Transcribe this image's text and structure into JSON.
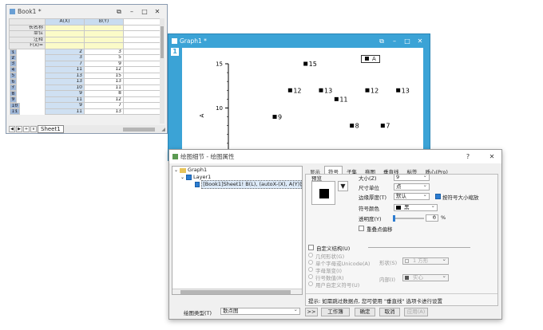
{
  "book": {
    "title": "Book1 *",
    "columns": [
      "A(X)",
      "B(Y)"
    ],
    "row_headers": [
      "长名称",
      "单位",
      "注释",
      "F(x)="
    ],
    "rows": [
      [
        "1",
        "2",
        "3"
      ],
      [
        "2",
        "3",
        "5"
      ],
      [
        "3",
        "7",
        "9"
      ],
      [
        "4",
        "11",
        "12"
      ],
      [
        "5",
        "13",
        "15"
      ],
      [
        "6",
        "13",
        "13"
      ],
      [
        "7",
        "10",
        "11"
      ],
      [
        "8",
        "9",
        "8"
      ],
      [
        "9",
        "11",
        "12"
      ],
      [
        "10",
        "9",
        "7"
      ],
      [
        "11",
        "11",
        "13"
      ]
    ],
    "sheet_tab": "Sheet1",
    "colors": {
      "selection": "#9eb7d8",
      "column_header": "#c9dcf0",
      "meta_rows": "#fbfbc8"
    }
  },
  "graph": {
    "title": "Graph1 *",
    "layer_number": "1",
    "legend_label": "A",
    "colors": {
      "frame": "#3ba3d6"
    }
  },
  "chart_data": {
    "type": "scatter",
    "x_label": "A",
    "y_ticks": [
      "15",
      "10"
    ],
    "ylim": [
      4,
      15
    ],
    "xlim": [
      0,
      12
    ],
    "points": [
      {
        "x": 3,
        "y": 9,
        "label": "9"
      },
      {
        "x": 4,
        "y": 12,
        "label": "12"
      },
      {
        "x": 5,
        "y": 15,
        "label": "15"
      },
      {
        "x": 6,
        "y": 12,
        "label": "13"
      },
      {
        "x": 7,
        "y": 11,
        "label": "11"
      },
      {
        "x": 8,
        "y": 8,
        "label": "8"
      },
      {
        "x": 9,
        "y": 12,
        "label": "12"
      },
      {
        "x": 10,
        "y": 8,
        "label": "7"
      },
      {
        "x": 11,
        "y": 12,
        "label": "13"
      }
    ]
  },
  "dialog": {
    "title": "绘图细节 - 绘图属性",
    "help": "?",
    "close": "✕",
    "tree": {
      "graph": "Graph1",
      "layer": "Layer1",
      "plot": "[Book1]Sheet1! B(L), (autoX-(X), A(Y)) [1*:1]"
    },
    "tabs": [
      "显示",
      "符号",
      "子集",
      "拖图",
      "垂直线",
      "标签",
      "质心(Pro)"
    ],
    "active_tab": "符号",
    "preview_label": "预览",
    "size_label": "大小(Z)",
    "size_value": "9",
    "size_unit_label": "尺寸单位",
    "size_unit_value": "点",
    "edge_label": "边缘厚度(T)",
    "edge_value": "默认",
    "scale_check": "按符号大小缩放",
    "color_label": "符号颜色",
    "color_value": "黑",
    "transparency_label": "透明度(Y)",
    "transparency_value": "0",
    "transparency_unit": "%",
    "overlap_check": "重叠点偏移",
    "custom_check": "自定义结构(U)",
    "radio_items": [
      "几何形状(G)",
      "单个字母或Unicode(A)",
      "字母渐变(I)",
      "行号数值(R)",
      "用户自定义符号(U)"
    ],
    "shape_label": "形状(S)",
    "shape_value": "1 方形",
    "inside_label": "内部(I)",
    "inside_value": "实心",
    "hint": "提示: 如需跳过数据点, 您可使用 \"垂直线\" 选项卡进行设置",
    "plot_type_label": "绘图类型(T)",
    "plot_type_value": "散点图",
    "buttons": [
      ">>",
      "工作簿",
      "确定",
      "取消",
      "应用(A)"
    ],
    "colors": {
      "accent": "#2c7cd1"
    }
  }
}
